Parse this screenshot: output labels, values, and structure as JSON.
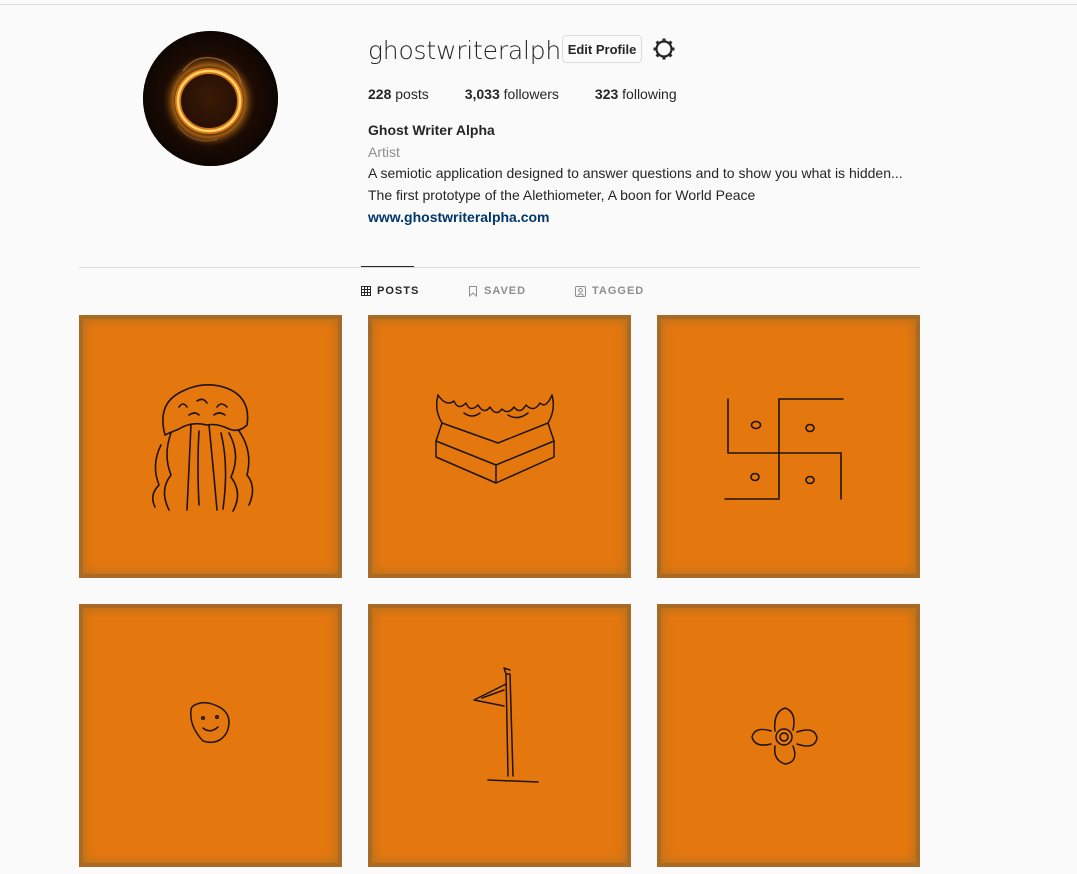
{
  "profile": {
    "username": "ghostwriteralpha",
    "edit_label": "Edit Profile",
    "stats": {
      "posts_count": "228",
      "posts_label": " posts",
      "followers_count": "3,033",
      "followers_label": " followers",
      "following_count": "323",
      "following_label": " following"
    },
    "full_name": "Ghost Writer Alpha",
    "category": "Artist",
    "bio_line1": "A semiotic application designed to answer questions and to show you what is hidden...",
    "bio_line2": "The first prototype of the Alethiometer, A boon for World Peace",
    "website": "www.ghostwriteralpha.com"
  },
  "tabs": [
    {
      "label": "POSTS",
      "icon": "grid-icon",
      "active": true
    },
    {
      "label": "SAVED",
      "icon": "bookmark-icon",
      "active": false
    },
    {
      "label": "TAGGED",
      "icon": "tag-portrait-icon",
      "active": false
    }
  ],
  "posts": [
    {
      "subject": "jellyfish-drawing"
    },
    {
      "subject": "fire-altar-drawing"
    },
    {
      "subject": "swastika-drawing"
    },
    {
      "subject": "face-drawing"
    },
    {
      "subject": "flag-on-pole-drawing"
    },
    {
      "subject": "flower-drawing"
    }
  ],
  "colors": {
    "post_background": "#e5770f",
    "post_frame": "#a86a25",
    "link": "#00376b",
    "muted": "#8e8e8e"
  }
}
